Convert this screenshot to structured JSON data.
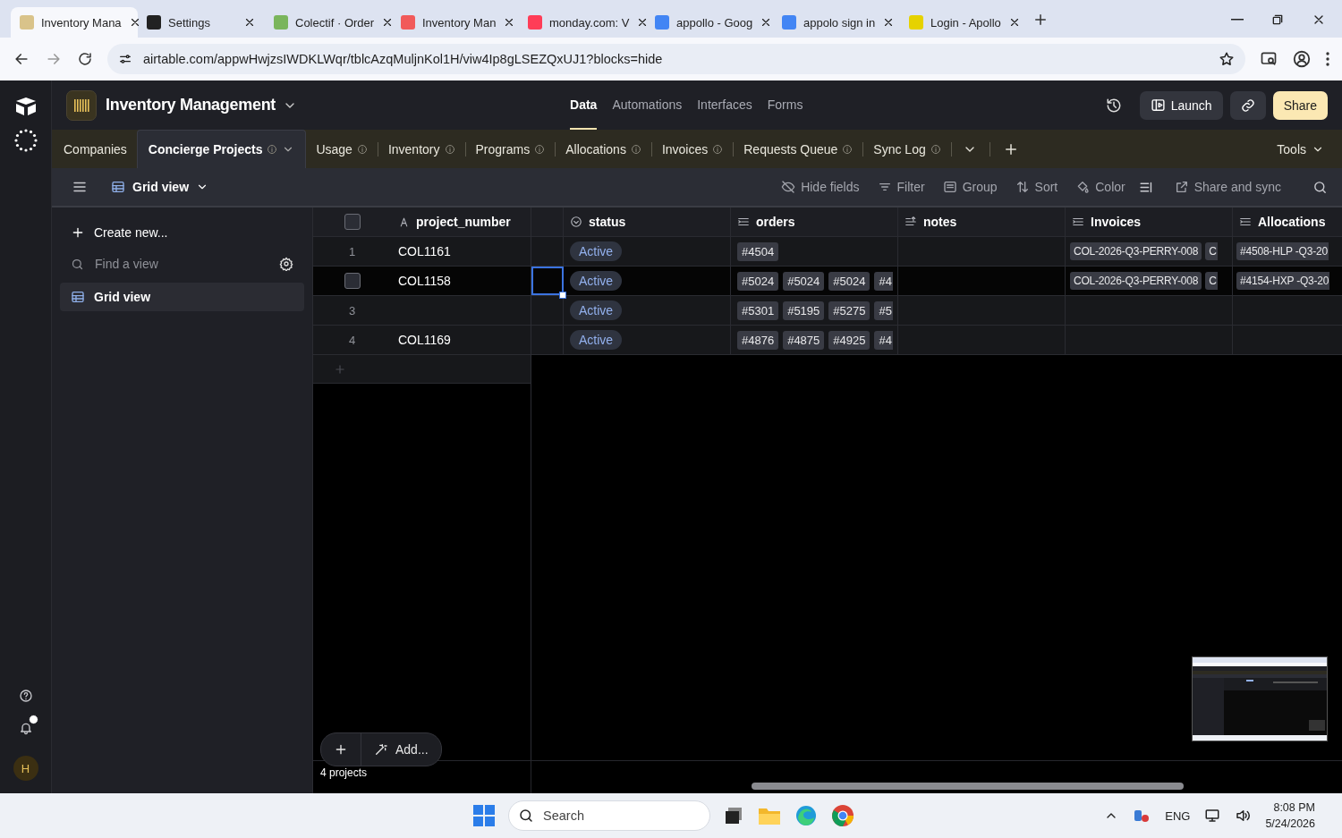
{
  "browser": {
    "tabs": [
      {
        "title": "Inventory Mana",
        "selected": true,
        "color": "#d9c38a"
      },
      {
        "title": "Settings",
        "selected": false,
        "color": "#222222"
      },
      {
        "title": "Colectif · Order",
        "selected": false,
        "color": "#7ab55c"
      },
      {
        "title": "Inventory Man",
        "selected": false,
        "color": "#f15a5a"
      },
      {
        "title": "monday.com: V",
        "selected": false,
        "color": "#ff3d57"
      },
      {
        "title": "appollo - Goog",
        "selected": false,
        "color": "#4285f4"
      },
      {
        "title": "appolo sign in",
        "selected": false,
        "color": "#4285f4"
      },
      {
        "title": "Login - Apollo",
        "selected": false,
        "color": "#e6d200"
      }
    ],
    "url": "airtable.com/appwHwjzsIWDKLWqr/tblcAzqMuljnKol1H/viw4Ip8gLSEZQxUJ1?blocks=hide"
  },
  "base": {
    "name": "Inventory Management",
    "nav": [
      {
        "label": "Data",
        "selected": true
      },
      {
        "label": "Automations",
        "selected": false
      },
      {
        "label": "Interfaces",
        "selected": false
      },
      {
        "label": "Forms",
        "selected": false
      }
    ],
    "buttons": [
      "Launch",
      "Share"
    ]
  },
  "tables": [
    {
      "label": "Companies",
      "selected": false,
      "info": false
    },
    {
      "label": "Concierge Projects",
      "selected": true,
      "info": true
    },
    {
      "label": "Usage",
      "selected": false,
      "info": true
    },
    {
      "label": "Inventory",
      "selected": false,
      "info": true
    },
    {
      "label": "Programs",
      "selected": false,
      "info": true
    },
    {
      "label": "Allocations",
      "selected": false,
      "info": true
    },
    {
      "label": "Invoices",
      "selected": false,
      "info": true
    },
    {
      "label": "Requests Queue",
      "selected": false,
      "info": true
    },
    {
      "label": "Sync Log",
      "selected": false,
      "info": true
    }
  ],
  "tools": "Tools",
  "view_bar": {
    "view": "Grid view",
    "actions": [
      "Hide fields",
      "Filter",
      "Group",
      "Sort",
      "Color",
      "Share and sync"
    ]
  },
  "sidebar": {
    "create": "Create new...",
    "search_placeholder": "Find a view",
    "views": [
      {
        "label": "Grid view",
        "selected": true
      }
    ]
  },
  "table": {
    "all_checked": false,
    "columns": [
      {
        "name": "project_number",
        "kind": "primary"
      },
      {
        "name": "status",
        "kind": "status"
      },
      {
        "name": "orders",
        "kind": "link"
      },
      {
        "name": "notes",
        "kind": "text"
      },
      {
        "name": "Invoices",
        "kind": "link"
      },
      {
        "name": "Allocations",
        "kind": "link"
      }
    ],
    "rows": [
      {
        "number": "1",
        "hovered": false,
        "cell_selected": false,
        "project_number": "COL1161",
        "status": "Active",
        "orders": [
          "#4504"
        ],
        "invoices": [
          "COL-2026-Q3-PERRY-008",
          "C"
        ],
        "allocations": [
          "#4508-HLP -Q3-20"
        ]
      },
      {
        "hovered": true,
        "cell_selected": true,
        "project_number": "COL1158",
        "status": "Active",
        "orders": [
          "#5024",
          "#5024",
          "#5024",
          "#4"
        ],
        "invoices": [
          "COL-2026-Q3-PERRY-008",
          "C"
        ],
        "allocations": [
          "#4154-HXP -Q3-20"
        ]
      },
      {
        "number": "3",
        "hovered": false,
        "cell_selected": false,
        "status": "Active",
        "orders": [
          "#5301",
          "#5195",
          "#5275",
          "#5"
        ]
      },
      {
        "number": "4",
        "hovered": false,
        "cell_selected": false,
        "project_number": "COL1169",
        "status": "Active",
        "orders": [
          "#4876",
          "#4875",
          "#4925",
          "#4"
        ]
      }
    ],
    "add_label": "Add...",
    "count": "4 projects"
  },
  "taskbar": {
    "search_placeholder": "Search",
    "language": "ENG",
    "time": "8:08 PM",
    "date": "5/24/2026"
  },
  "user_initial": "H"
}
